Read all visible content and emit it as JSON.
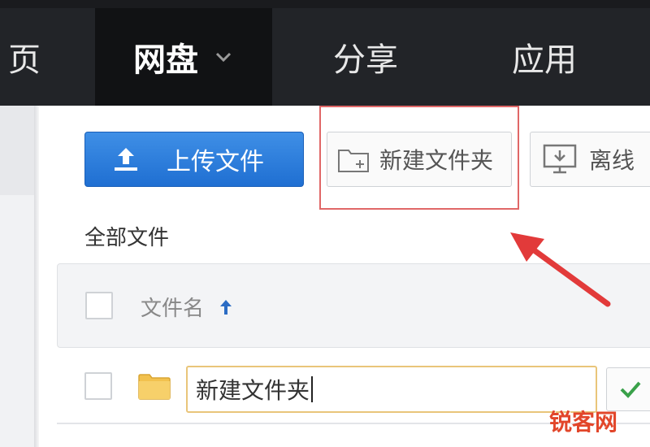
{
  "nav": {
    "home": "页",
    "disk": "网盘",
    "share": "分享",
    "apps": "应用"
  },
  "toolbar": {
    "upload_label": "上传文件",
    "new_folder_label": "新建文件夹",
    "offline_label": "离线"
  },
  "breadcrumb": "全部文件",
  "list": {
    "column_name": "文件名"
  },
  "new_folder_row": {
    "input_value": "新建文件夹"
  },
  "colors": {
    "topbar": "#222428",
    "upload_button": "#1f6fd2",
    "highlight": "#e06767",
    "watermark": "#e2462a"
  },
  "icons": [
    "upload-icon",
    "new-folder-icon",
    "offline-download-icon",
    "chevron-down-icon",
    "sort-up-arrow-icon",
    "folder-icon",
    "checkmark-icon"
  ],
  "watermark": "锐客网"
}
